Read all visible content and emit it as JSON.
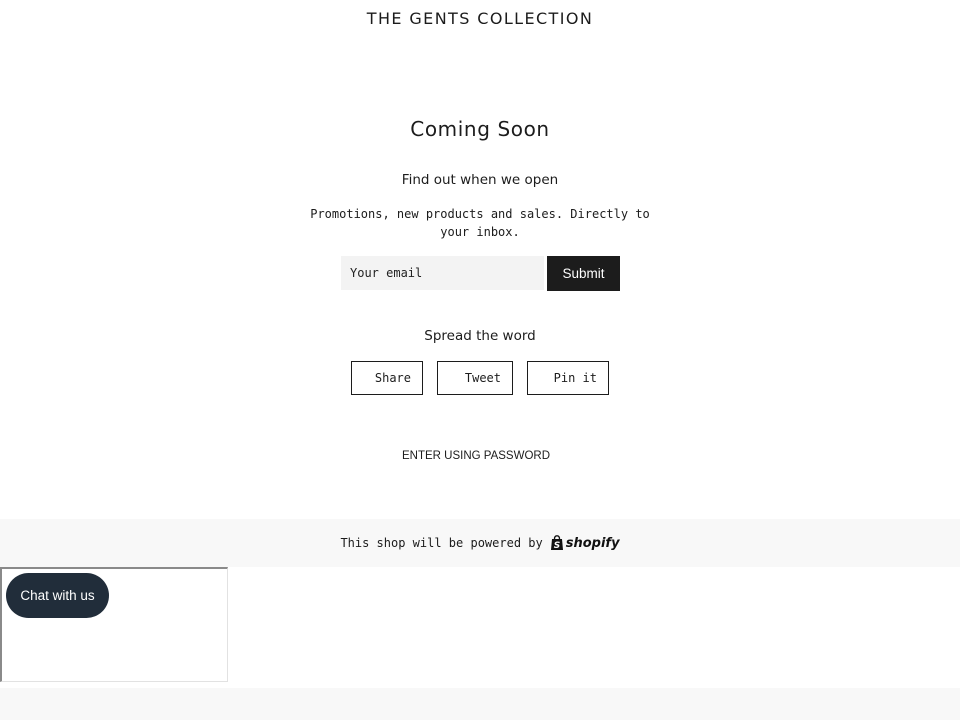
{
  "header": {
    "shop_name": "THE GENTS COLLECTION"
  },
  "main": {
    "heading": "Coming Soon",
    "subheading": "Find out when we open",
    "description": "Promotions, new products and sales. Directly to your inbox.",
    "newsletter": {
      "email_placeholder": "Your email",
      "email_value": "",
      "submit_label": "Submit"
    },
    "share": {
      "heading": "Spread the word",
      "buttons": [
        {
          "label": "Share",
          "network": "facebook"
        },
        {
          "label": "Tweet",
          "network": "twitter"
        },
        {
          "label": "Pin it",
          "network": "pinterest"
        }
      ]
    },
    "password_link": "ENTER USING PASSWORD"
  },
  "footer": {
    "powered_by": "This shop will be powered by",
    "brand": "shopify",
    "brand_icon": "shopify-bag-icon"
  },
  "chat": {
    "label": "Chat with us",
    "color": "#212d3a"
  },
  "colors": {
    "primary": "#1c1c1c",
    "input_bg": "#f3f3f3",
    "footer_bg": "#f8f8f8"
  }
}
